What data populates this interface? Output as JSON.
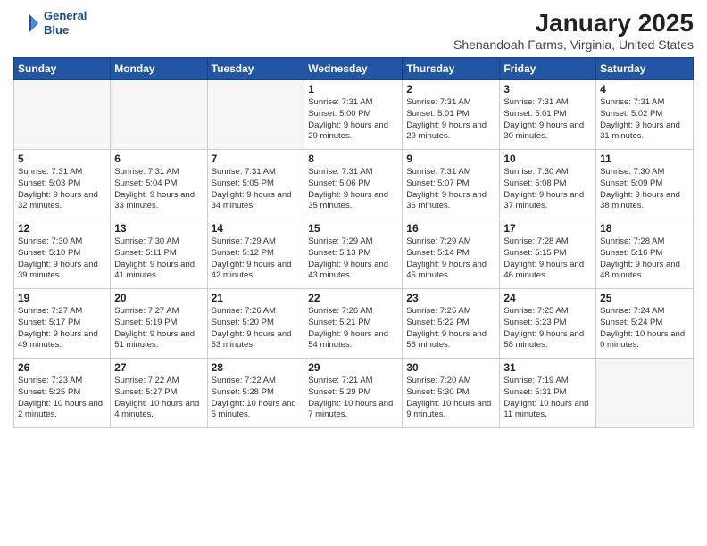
{
  "header": {
    "logo_line1": "General",
    "logo_line2": "Blue",
    "title": "January 2025",
    "subtitle": "Shenandoah Farms, Virginia, United States"
  },
  "days_of_week": [
    "Sunday",
    "Monday",
    "Tuesday",
    "Wednesday",
    "Thursday",
    "Friday",
    "Saturday"
  ],
  "weeks": [
    [
      {
        "day": "",
        "empty": true
      },
      {
        "day": "",
        "empty": true
      },
      {
        "day": "",
        "empty": true
      },
      {
        "day": "1",
        "sunrise": "7:31 AM",
        "sunset": "5:00 PM",
        "daylight": "9 hours and 29 minutes."
      },
      {
        "day": "2",
        "sunrise": "7:31 AM",
        "sunset": "5:01 PM",
        "daylight": "9 hours and 29 minutes."
      },
      {
        "day": "3",
        "sunrise": "7:31 AM",
        "sunset": "5:01 PM",
        "daylight": "9 hours and 30 minutes."
      },
      {
        "day": "4",
        "sunrise": "7:31 AM",
        "sunset": "5:02 PM",
        "daylight": "9 hours and 31 minutes."
      }
    ],
    [
      {
        "day": "5",
        "sunrise": "7:31 AM",
        "sunset": "5:03 PM",
        "daylight": "9 hours and 32 minutes."
      },
      {
        "day": "6",
        "sunrise": "7:31 AM",
        "sunset": "5:04 PM",
        "daylight": "9 hours and 33 minutes."
      },
      {
        "day": "7",
        "sunrise": "7:31 AM",
        "sunset": "5:05 PM",
        "daylight": "9 hours and 34 minutes."
      },
      {
        "day": "8",
        "sunrise": "7:31 AM",
        "sunset": "5:06 PM",
        "daylight": "9 hours and 35 minutes."
      },
      {
        "day": "9",
        "sunrise": "7:31 AM",
        "sunset": "5:07 PM",
        "daylight": "9 hours and 36 minutes."
      },
      {
        "day": "10",
        "sunrise": "7:30 AM",
        "sunset": "5:08 PM",
        "daylight": "9 hours and 37 minutes."
      },
      {
        "day": "11",
        "sunrise": "7:30 AM",
        "sunset": "5:09 PM",
        "daylight": "9 hours and 38 minutes."
      }
    ],
    [
      {
        "day": "12",
        "sunrise": "7:30 AM",
        "sunset": "5:10 PM",
        "daylight": "9 hours and 39 minutes."
      },
      {
        "day": "13",
        "sunrise": "7:30 AM",
        "sunset": "5:11 PM",
        "daylight": "9 hours and 41 minutes."
      },
      {
        "day": "14",
        "sunrise": "7:29 AM",
        "sunset": "5:12 PM",
        "daylight": "9 hours and 42 minutes."
      },
      {
        "day": "15",
        "sunrise": "7:29 AM",
        "sunset": "5:13 PM",
        "daylight": "9 hours and 43 minutes."
      },
      {
        "day": "16",
        "sunrise": "7:29 AM",
        "sunset": "5:14 PM",
        "daylight": "9 hours and 45 minutes."
      },
      {
        "day": "17",
        "sunrise": "7:28 AM",
        "sunset": "5:15 PM",
        "daylight": "9 hours and 46 minutes."
      },
      {
        "day": "18",
        "sunrise": "7:28 AM",
        "sunset": "5:16 PM",
        "daylight": "9 hours and 48 minutes."
      }
    ],
    [
      {
        "day": "19",
        "sunrise": "7:27 AM",
        "sunset": "5:17 PM",
        "daylight": "9 hours and 49 minutes."
      },
      {
        "day": "20",
        "sunrise": "7:27 AM",
        "sunset": "5:19 PM",
        "daylight": "9 hours and 51 minutes."
      },
      {
        "day": "21",
        "sunrise": "7:26 AM",
        "sunset": "5:20 PM",
        "daylight": "9 hours and 53 minutes."
      },
      {
        "day": "22",
        "sunrise": "7:26 AM",
        "sunset": "5:21 PM",
        "daylight": "9 hours and 54 minutes."
      },
      {
        "day": "23",
        "sunrise": "7:25 AM",
        "sunset": "5:22 PM",
        "daylight": "9 hours and 56 minutes."
      },
      {
        "day": "24",
        "sunrise": "7:25 AM",
        "sunset": "5:23 PM",
        "daylight": "9 hours and 58 minutes."
      },
      {
        "day": "25",
        "sunrise": "7:24 AM",
        "sunset": "5:24 PM",
        "daylight": "10 hours and 0 minutes."
      }
    ],
    [
      {
        "day": "26",
        "sunrise": "7:23 AM",
        "sunset": "5:25 PM",
        "daylight": "10 hours and 2 minutes."
      },
      {
        "day": "27",
        "sunrise": "7:22 AM",
        "sunset": "5:27 PM",
        "daylight": "10 hours and 4 minutes."
      },
      {
        "day": "28",
        "sunrise": "7:22 AM",
        "sunset": "5:28 PM",
        "daylight": "10 hours and 5 minutes."
      },
      {
        "day": "29",
        "sunrise": "7:21 AM",
        "sunset": "5:29 PM",
        "daylight": "10 hours and 7 minutes."
      },
      {
        "day": "30",
        "sunrise": "7:20 AM",
        "sunset": "5:30 PM",
        "daylight": "10 hours and 9 minutes."
      },
      {
        "day": "31",
        "sunrise": "7:19 AM",
        "sunset": "5:31 PM",
        "daylight": "10 hours and 11 minutes."
      },
      {
        "day": "",
        "empty": true
      }
    ]
  ]
}
